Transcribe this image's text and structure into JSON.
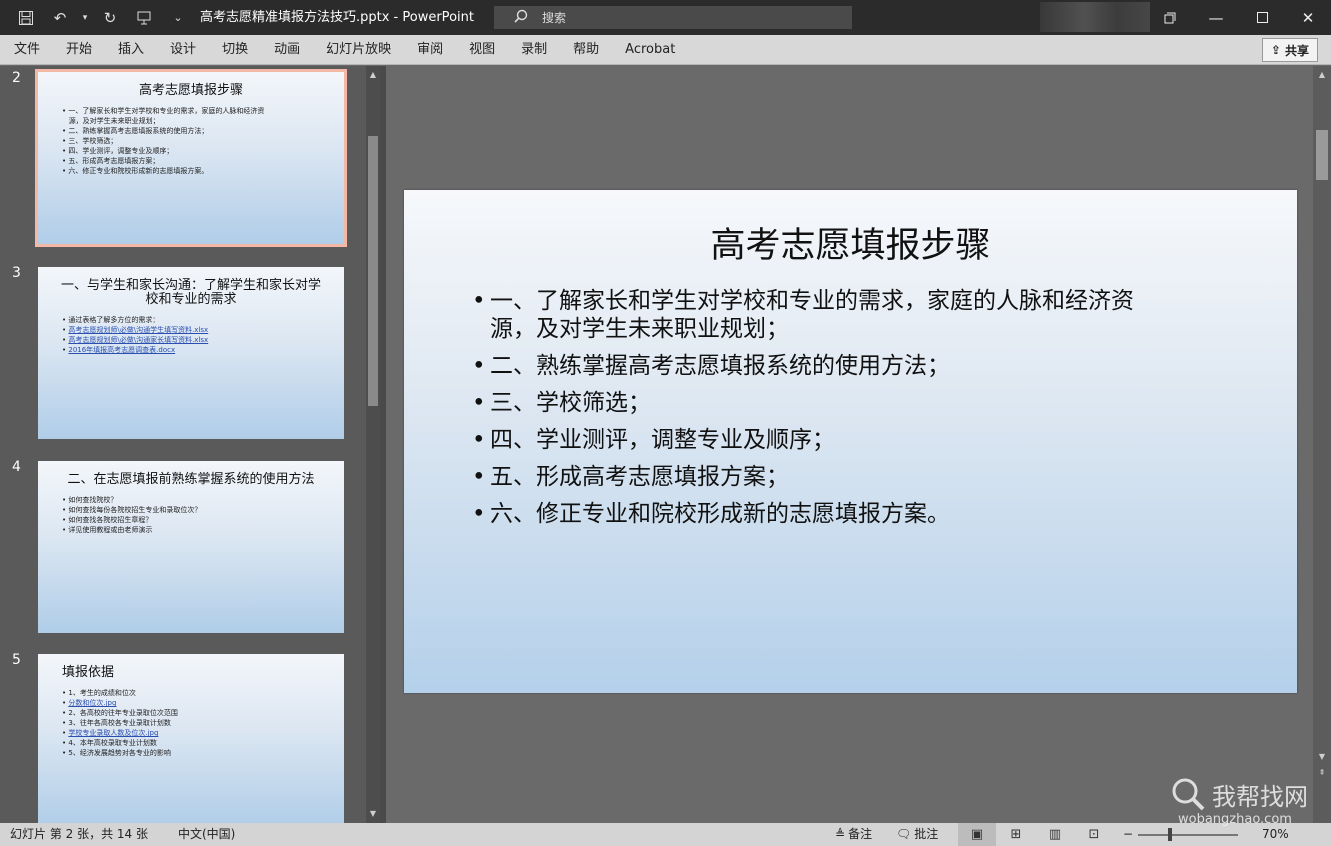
{
  "app": {
    "doc_title": "高考志愿精准填报方法技巧.pptx  -  PowerPoint",
    "search_placeholder": "搜索"
  },
  "menu": [
    "文件",
    "开始",
    "插入",
    "设计",
    "切换",
    "动画",
    "幻灯片放映",
    "审阅",
    "视图",
    "录制",
    "帮助",
    "Acrobat"
  ],
  "share_label": "共享",
  "thumbnails": [
    {
      "num": "2",
      "title": "高考志愿填报步骤",
      "items": [
        "一、了解家长和学生对学校和专业的需求，家庭的人脉和经济资",
        "源，及对学生未来职业规划；",
        "二、熟练掌握高考志愿填报系统的使用方法；",
        "三、学校筛选；",
        "四、学业测评，调整专业及顺序；",
        "五、形成高考志愿填报方案；",
        "六、修正专业和院校形成新的志愿填报方案。"
      ]
    },
    {
      "num": "3",
      "title": "一、与学生和家长沟通：了解学生和家长对学校和专业的需求",
      "items": [
        "通过表格了解多方位的需求：",
        "高考志愿规划师\\必做\\沟通学生填写资料.xlsx",
        "高考志愿规划师\\必做\\沟通家长填写资料.xlsx",
        "2016年填报高考志愿调查表.docx"
      ]
    },
    {
      "num": "4",
      "title": "二、在志愿填报前熟练掌握系统的使用方法",
      "items": [
        "如何查找院校？",
        "如何查找每份各院校招生专业和录取位次？",
        "如何查找各院校招生章程？",
        "详见使用教程或由老师演示"
      ]
    },
    {
      "num": "5",
      "title": "填报依据",
      "items": [
        "1、考生的成绩和位次",
        "分数和位次.jpg",
        "2、各高校的往年专业录取位次范围",
        "3、往年各高校各专业录取计划数",
        "学校专业录取人数及位次.jpg",
        "4、本年高校录取专业计划数",
        "5、经济发展趋势对各专业的影响"
      ]
    }
  ],
  "main_slide": {
    "title": "高考志愿填报步骤",
    "bullets": [
      "一、了解家长和学生对学校和专业的需求，家庭的人脉和经济资",
      "源，及对学生未来职业规划；",
      "二、熟练掌握高考志愿填报系统的使用方法；",
      "三、学校筛选；",
      "四、学业测评，调整专业及顺序；",
      "五、形成高考志愿填报方案；",
      "六、修正专业和院校形成新的志愿填报方案。"
    ]
  },
  "status": {
    "slide_info": "幻灯片 第 2 张，共 14 张",
    "language": "中文(中国)",
    "notes": "备注",
    "comments": "批注",
    "zoom": "70%"
  },
  "watermark": {
    "text": "我帮找网",
    "sub": "wobangzhao.com"
  }
}
